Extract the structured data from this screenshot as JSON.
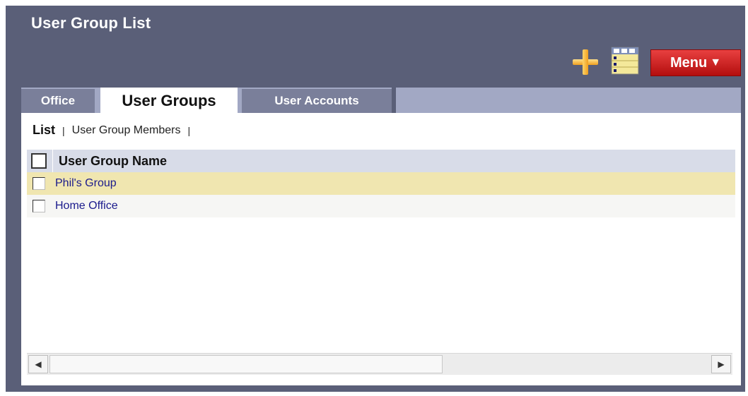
{
  "header": {
    "title": "User Group List",
    "add_icon": "plus-icon",
    "list_icon": "list-view-icon",
    "menu_label": "Menu",
    "menu_caret": "▼"
  },
  "tabs": [
    {
      "label": "Office",
      "active": false
    },
    {
      "label": "User Groups",
      "active": true
    },
    {
      "label": "User Accounts",
      "active": false
    }
  ],
  "subnav": {
    "list_label": "List",
    "separator": "|",
    "members_label": "User Group Members"
  },
  "table": {
    "column_header": "User Group Name",
    "rows": [
      {
        "name": "Phil's Group",
        "selected": true
      },
      {
        "name": "Home Office",
        "selected": false
      }
    ]
  },
  "scrollbar": {
    "left_arrow": "◀",
    "right_arrow": "▶"
  },
  "colors": {
    "panel": "#5a5f78",
    "menu_red": "#c81818",
    "selected_row": "#f0e6b0",
    "link": "#1a1a8c"
  }
}
